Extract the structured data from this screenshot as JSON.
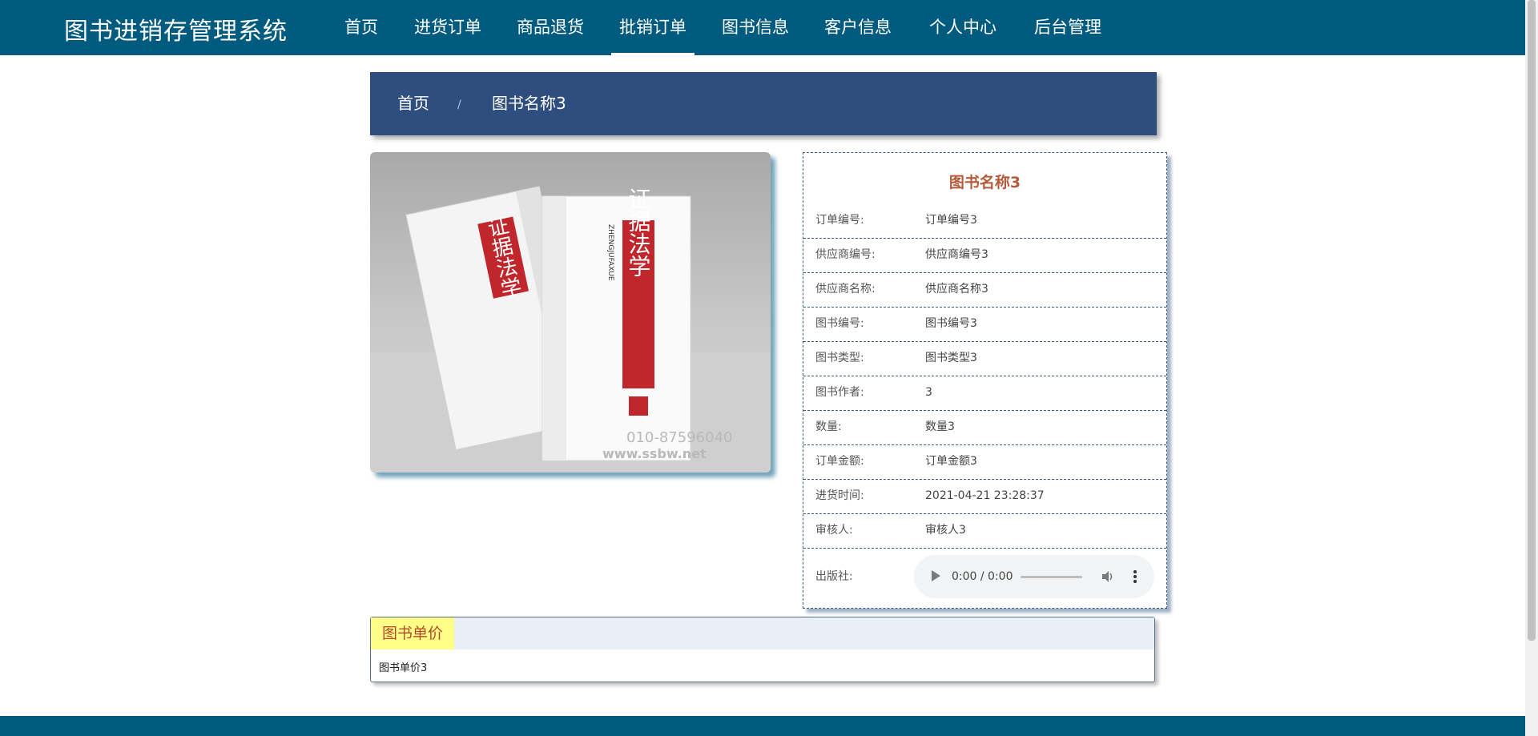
{
  "app": {
    "title": "图书进销存管理系统"
  },
  "nav": {
    "items": [
      {
        "label": "首页"
      },
      {
        "label": "进货订单"
      },
      {
        "label": "商品退货"
      },
      {
        "label": "批销订单",
        "active": true
      },
      {
        "label": "图书信息"
      },
      {
        "label": "客户信息"
      },
      {
        "label": "个人中心"
      },
      {
        "label": "后台管理"
      }
    ]
  },
  "breadcrumb": {
    "home": "首页",
    "separator": "/",
    "current": "图书名称3"
  },
  "cover": {
    "alt_icon": "book-cover-image",
    "title_vertical": "证据法学",
    "pinyin": "ZHENGJUFAXUE",
    "watermark_phone": "010-87596040",
    "watermark_url": "www.ssbw.net"
  },
  "info": {
    "title": "图书名称3",
    "rows": [
      {
        "label": "订单编号:",
        "value": "订单编号3"
      },
      {
        "label": "供应商编号:",
        "value": "供应商编号3"
      },
      {
        "label": "供应商名称:",
        "value": "供应商名称3"
      },
      {
        "label": "图书编号:",
        "value": "图书编号3"
      },
      {
        "label": "图书类型:",
        "value": "图书类型3"
      },
      {
        "label": "图书作者:",
        "value": "3"
      },
      {
        "label": "数量:",
        "value": "数量3"
      },
      {
        "label": "订单金额:",
        "value": "订单金额3"
      },
      {
        "label": "进货时间:",
        "value": "2021-04-21 23:28:37"
      },
      {
        "label": "审核人:",
        "value": "审核人3"
      }
    ],
    "publisher_label": "出版社:",
    "audio_time": "0:00 / 0:00"
  },
  "price": {
    "tab_label": "图书单价",
    "value": "图书单价3"
  },
  "colors": {
    "topbar": "#005b7f",
    "breadcrumb": "#2d4e7e",
    "title_accent": "#b35a3a",
    "tab_highlight": "#ffff88"
  }
}
